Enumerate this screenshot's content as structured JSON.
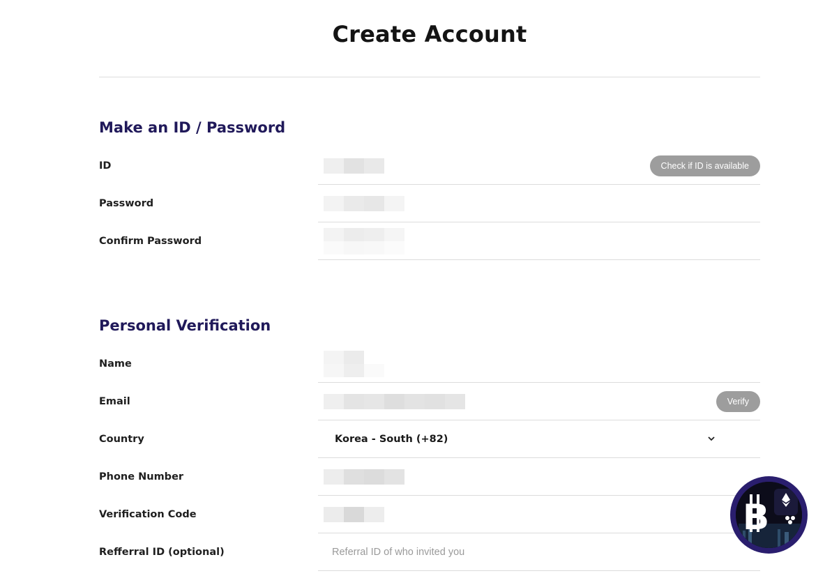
{
  "page": {
    "title": "Create Account"
  },
  "sections": {
    "account": {
      "heading": "Make an ID / Password",
      "fields": {
        "id": {
          "label": "ID",
          "button": "Check if ID is available"
        },
        "password": {
          "label": "Password"
        },
        "confirm_password": {
          "label": "Confirm Password"
        }
      }
    },
    "verification": {
      "heading": "Personal Verification",
      "fields": {
        "name": {
          "label": "Name"
        },
        "email": {
          "label": "Email",
          "button": "Verify"
        },
        "country": {
          "label": "Country",
          "selected": "Korea - South (+82)"
        },
        "phone": {
          "label": "Phone Number"
        },
        "code": {
          "label": "Verification Code"
        },
        "referral": {
          "label": "Refferral ID (optional)",
          "placeholder": "Referral ID of who invited you"
        }
      }
    }
  },
  "icons": {
    "chevron": "chevron-down-icon",
    "logo": "crypto-coin-logo"
  },
  "colors": {
    "heading": "#20195a",
    "button": "#9d9d9d",
    "divider": "#dcdcdc",
    "logo_ring": "#2a1e6e"
  }
}
